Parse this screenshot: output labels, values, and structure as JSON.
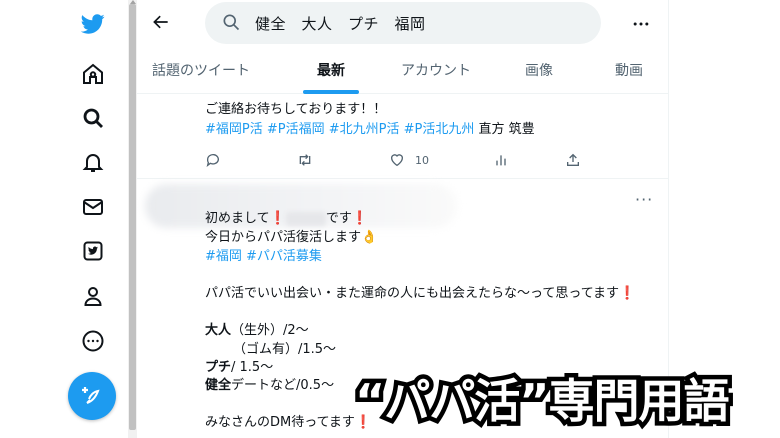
{
  "search": {
    "query": "健全　大人　プチ　福岡"
  },
  "tabs": [
    {
      "label": "話題のツイート",
      "active": false
    },
    {
      "label": "最新",
      "active": true
    },
    {
      "label": "アカウント",
      "active": false
    },
    {
      "label": "画像",
      "active": false
    },
    {
      "label": "動画",
      "active": false
    }
  ],
  "tweet1": {
    "line1": "ご連絡お待ちしております！！",
    "hashtags": "#福岡P活 #P活福岡 #北九州P活 #P活北九州",
    "suffix": " 直方 筑豊",
    "like_count": "10"
  },
  "tweet2": {
    "greeting_pre": "初めまして",
    "greeting_post": "です",
    "line2": "今日からパパ活復活します👌",
    "hashtags": "#福岡 #パパ活募集",
    "line4": "パパ活でいい出会い・また運命の人にも出会えたらな〜って思ってます",
    "otona_label": "大人",
    "otona_1": "（生外）/2〜",
    "otona_2": "（ゴム有）/1.5〜",
    "puchi_label": "プチ",
    "puchi_val": "/ 1.5〜",
    "kenzen_label": "健全",
    "kenzen_val": "デートなど/0.5〜",
    "closing": "みなさんのDM待ってます"
  },
  "caption": "“パパ活”専門用語",
  "colors": {
    "accent": "#1d9bf0",
    "text": "#0f1419",
    "muted": "#536471",
    "exclaim": "#d1202a"
  }
}
